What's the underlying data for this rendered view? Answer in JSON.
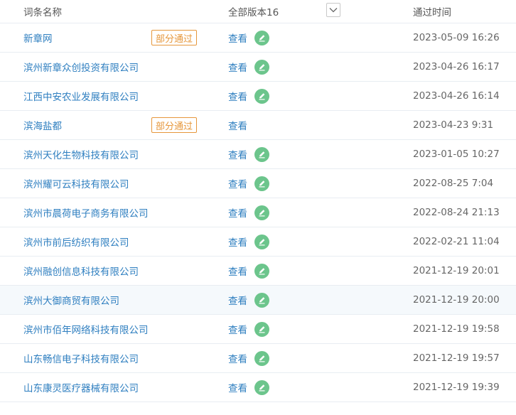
{
  "header": {
    "name_label": "词条名称",
    "version_label": "全部版本16",
    "time_label": "通过时间",
    "dropdown_icon": "chevron-down-icon"
  },
  "colors": {
    "link": "#2f7fc0",
    "badge": "#e6973b",
    "edit": "#6cc58c"
  },
  "rows": [
    {
      "name": "新章网",
      "badge": "部分通过",
      "view": "查看",
      "editable": true,
      "time": "2023-05-09 16:26"
    },
    {
      "name": "滨州新章众创投资有限公司",
      "badge": "",
      "view": "查看",
      "editable": true,
      "time": "2023-04-26 16:17"
    },
    {
      "name": "江西中安农业发展有限公司",
      "badge": "",
      "view": "查看",
      "editable": true,
      "time": "2023-04-26 16:14"
    },
    {
      "name": "滨海盐都",
      "badge": "部分通过",
      "view": "查看",
      "editable": false,
      "time": "2023-04-23 9:31"
    },
    {
      "name": "滨州天化生物科技有限公司",
      "badge": "",
      "view": "查看",
      "editable": true,
      "time": "2023-01-05 10:27"
    },
    {
      "name": "滨州耀可云科技有限公司",
      "badge": "",
      "view": "查看",
      "editable": true,
      "time": "2022-08-25 7:04"
    },
    {
      "name": "滨州市晨荷电子商务有限公司",
      "badge": "",
      "view": "查看",
      "editable": true,
      "time": "2022-08-24 21:13"
    },
    {
      "name": "滨州市前后纺织有限公司",
      "badge": "",
      "view": "查看",
      "editable": true,
      "time": "2022-02-21 11:04"
    },
    {
      "name": "滨州融创信息科技有限公司",
      "badge": "",
      "view": "查看",
      "editable": true,
      "time": "2021-12-19 20:01"
    },
    {
      "name": "滨州大御商贸有限公司",
      "badge": "",
      "view": "查看",
      "editable": true,
      "time": "2021-12-19 20:00",
      "hover": true
    },
    {
      "name": "滨州市佰年网络科技有限公司",
      "badge": "",
      "view": "查看",
      "editable": true,
      "time": "2021-12-19 19:58"
    },
    {
      "name": "山东畅信电子科技有限公司",
      "badge": "",
      "view": "查看",
      "editable": true,
      "time": "2021-12-19 19:57"
    },
    {
      "name": "山东康灵医疗器械有限公司",
      "badge": "",
      "view": "查看",
      "editable": true,
      "time": "2021-12-19 19:39"
    }
  ]
}
